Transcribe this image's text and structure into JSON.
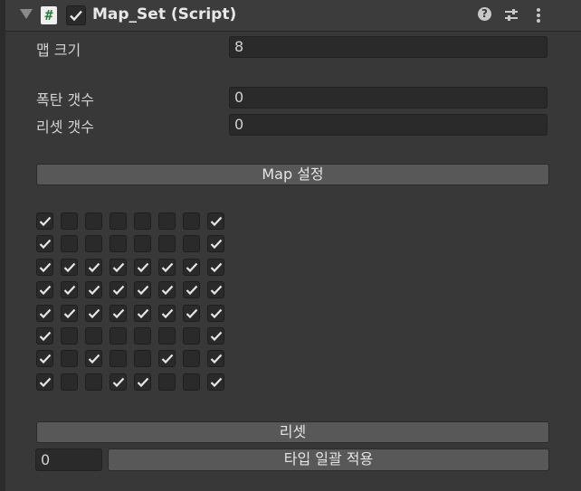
{
  "component": {
    "title": "Map_Set (Script)",
    "script_icon": "#",
    "enabled": true,
    "header_icons": [
      "help-icon",
      "preset-icon",
      "more-icon"
    ]
  },
  "fields": {
    "map_size_label": "맵 크기",
    "map_size_value": "8",
    "bomb_count_label": "폭탄 갯수",
    "bomb_count_value": "0",
    "reset_count_label": "리셋 갯수",
    "reset_count_value": "0"
  },
  "buttons": {
    "map_set": "Map 설정",
    "reset": "리셋",
    "apply_all": "타입 일괄 적용"
  },
  "tile_type_value": "0",
  "grid": [
    [
      true,
      false,
      false,
      false,
      false,
      false,
      false,
      true
    ],
    [
      true,
      false,
      false,
      false,
      false,
      false,
      false,
      true
    ],
    [
      true,
      true,
      true,
      true,
      true,
      true,
      true,
      true
    ],
    [
      true,
      true,
      true,
      true,
      true,
      true,
      true,
      true
    ],
    [
      true,
      true,
      true,
      true,
      true,
      true,
      true,
      true
    ],
    [
      true,
      false,
      false,
      false,
      false,
      false,
      false,
      true
    ],
    [
      true,
      false,
      true,
      false,
      false,
      true,
      false,
      true
    ],
    [
      true,
      false,
      false,
      true,
      true,
      false,
      false,
      true
    ]
  ]
}
